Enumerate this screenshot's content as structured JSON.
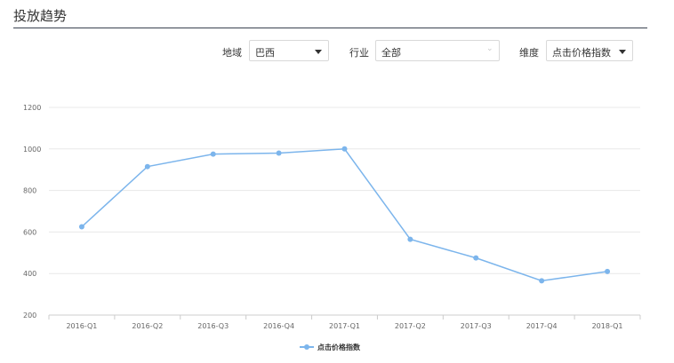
{
  "header": {
    "title": "投放趋势"
  },
  "filters": {
    "region": {
      "label": "地域",
      "value": "巴西"
    },
    "industry": {
      "label": "行业",
      "value": "全部"
    },
    "dimension": {
      "label": "维度",
      "value": "点击价格指数"
    }
  },
  "colors": {
    "line": "#7cb5ec",
    "title_rule": "#3a4250",
    "grid": "#e8e8e8"
  },
  "chart_data": {
    "type": "line",
    "categories": [
      "2016-Q1",
      "2016-Q2",
      "2016-Q3",
      "2016-Q4",
      "2017-Q1",
      "2017-Q2",
      "2017-Q3",
      "2017-Q4",
      "2018-Q1"
    ],
    "series": [
      {
        "name": "点击价格指数",
        "values": [
          625,
          915,
          975,
          980,
          1000,
          565,
          475,
          365,
          410
        ]
      }
    ],
    "yticks": [
      200,
      400,
      600,
      800,
      1000,
      1200
    ],
    "ylim": [
      200,
      1200
    ],
    "title": "",
    "xlabel": "",
    "ylabel": "",
    "grid": true,
    "legend": "bottom-center"
  }
}
